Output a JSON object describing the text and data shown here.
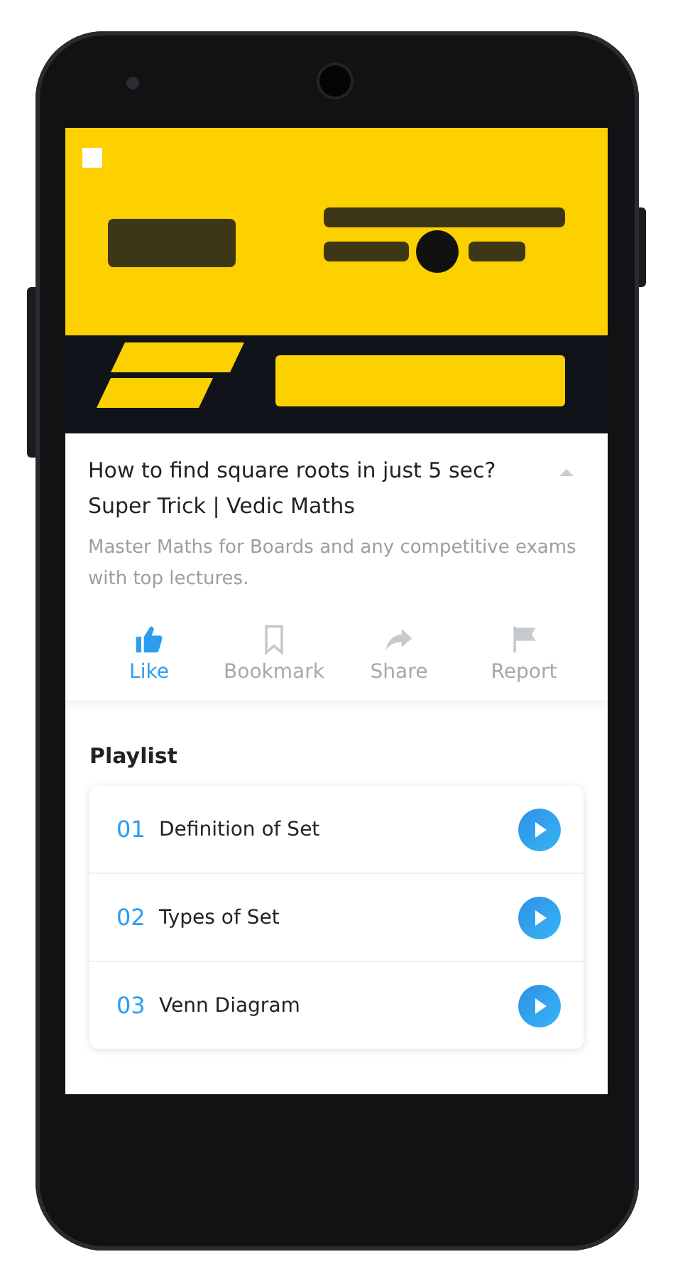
{
  "info": {
    "title": "How to find square roots in just 5 sec? Super Trick | Vedic Maths",
    "expanded": true,
    "description": "Master Maths for Boards and any competitive exams with top lectures."
  },
  "actions": [
    {
      "kind": "like",
      "label": "Like",
      "selected": true
    },
    {
      "kind": "bookmark",
      "label": "Bookmark",
      "selected": false
    },
    {
      "kind": "share",
      "label": "Share",
      "selected": false
    },
    {
      "kind": "report",
      "label": "Report",
      "selected": false
    }
  ],
  "playlist": {
    "heading": "Playlist",
    "items": [
      {
        "number": "01",
        "title": "Definition of Set"
      },
      {
        "number": "02",
        "title": "Types of Set"
      },
      {
        "number": "03",
        "title": "Venn Diagram"
      }
    ]
  }
}
